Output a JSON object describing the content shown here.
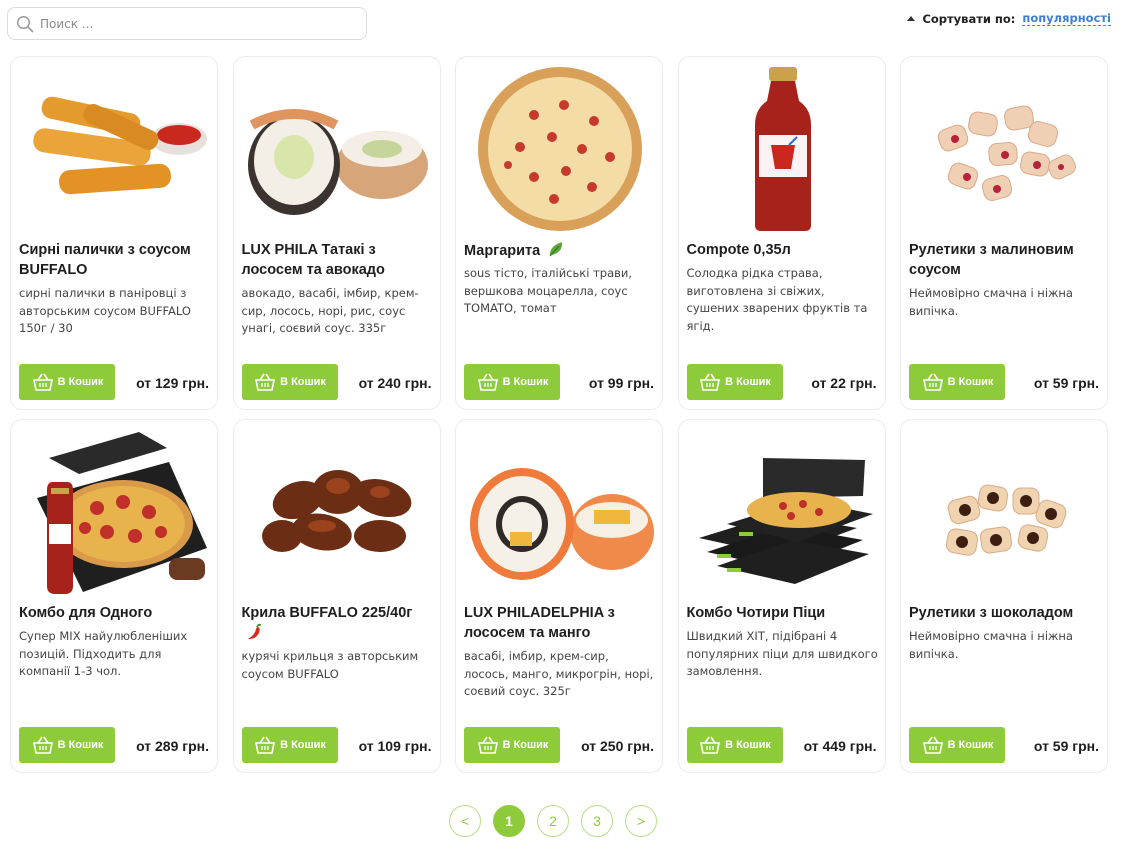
{
  "search": {
    "placeholder": "Поиск ..."
  },
  "sort": {
    "label": "Сортувати по:",
    "value": "популярності"
  },
  "products": [
    {
      "title": "Сирні палички з соусом BUFFALO",
      "desc": "сирні палички в паніровці з авторським соусом BUFFALO 150г / 30",
      "button": "В Кошик",
      "price": "от 129 грн.",
      "image": "cheese-sticks-image"
    },
    {
      "title": "LUX PHILA Татакі з лососем та авокадо",
      "desc": "авокадо, васабі, імбир, крем-сир, лосось, норі, рис, соус унагі, соєвий соус. 335г",
      "button": "В Кошик",
      "price": "от 240 грн.",
      "image": "sushi-roll-image"
    },
    {
      "title": "Маргарита",
      "desc": "sous тісто, італійські трави, вершкова моцарелла, соус TOMATO, томат",
      "button": "В Кошик",
      "price": "от 99 грн.",
      "image": "pizza-image",
      "badge": "leaf-icon"
    },
    {
      "title": "Compote 0,35л",
      "desc": "Солодка рідка страва, виготовлена зі свіжих, сушених зварених фруктів та ягід.",
      "button": "В Кошик",
      "price": "от 22 грн.",
      "image": "compote-bottle-image"
    },
    {
      "title": "Рулетики з малиновим соусом",
      "desc": "Неймовірно смачна і ніжна випічка.",
      "button": "В Кошик",
      "price": "от 59 грн.",
      "image": "raspberry-rolls-image"
    },
    {
      "title": "Комбо для Одного",
      "desc": "Супер MIX найулюбленіших позицій. Підходить для компанії 1-3 чол.",
      "button": "В Кошик",
      "price": "от 289 грн.",
      "image": "combo-box-image"
    },
    {
      "title": "Крила BUFFALO 225/40г",
      "desc": "курячі крильця з авторським соусом BUFFALO",
      "button": "В Кошик",
      "price": "от 109 грн.",
      "image": "chicken-wings-image",
      "badge": "chili-icon"
    },
    {
      "title": "LUX PHILADELPHIA з лососем та манго",
      "desc": "васабі, імбир, крем-сир, лосось, манго, микрогрін, норі, соєвий соус. 325г",
      "button": "В Кошик",
      "price": "от 250 грн.",
      "image": "philadelphia-roll-image"
    },
    {
      "title": "Комбо Чотири Піци",
      "desc": "Швидкий ХІТ, підібрані 4 популярних піци для швидкого замовлення.",
      "button": "В Кошик",
      "price": "от 449 грн.",
      "image": "four-pizza-boxes-image"
    },
    {
      "title": "Рулетики з шоколадом",
      "desc": "Неймовірно смачна і ніжна випічка.",
      "button": "В Кошик",
      "price": "от 59 грн.",
      "image": "chocolate-rolls-image"
    }
  ],
  "pagination": {
    "prev": "<",
    "pages": [
      "1",
      "2",
      "3"
    ],
    "next": ">",
    "current": "1"
  },
  "colors": {
    "accent": "#8ecb3a",
    "link": "#3d7fd1"
  }
}
